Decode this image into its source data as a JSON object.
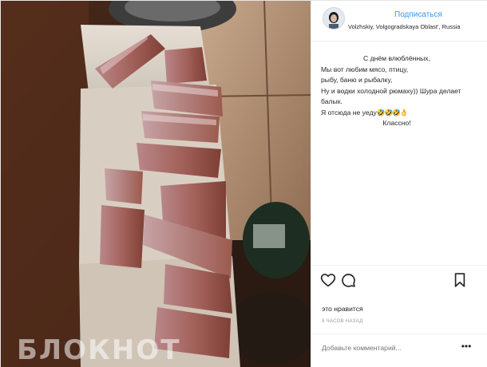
{
  "header": {
    "subscribe_label": "Подписаться",
    "location": "Volzhskiy, Volgogradskaya Oblast', Russia"
  },
  "photo": {
    "watermark": "БЛОКНОТ"
  },
  "caption": {
    "greeting": "С днём влюблённых,",
    "line2": "Мы вот любим мясо, птицу,",
    "line3": "рыбу, баню и рыбалку,",
    "line4": "Ну и водки холодной рюмаху)) Шура делает",
    "line5": "балык.",
    "line6": "Я отсюда не уеду",
    "line6_emoji": "🤣🤣🤣👌",
    "closing": "Классно!"
  },
  "actions": {
    "like_icon": "heart-icon",
    "comment_icon": "comment-icon",
    "save_icon": "bookmark-icon"
  },
  "likes_text": "это нравится",
  "time_text": "8 ЧАСОВ НАЗАД",
  "comment": {
    "placeholder": "Добавьте комментарий..."
  },
  "more_label": "•••",
  "colors": {
    "link": "#3897f0",
    "text": "#262626",
    "muted": "#999999",
    "border": "#efefef"
  }
}
